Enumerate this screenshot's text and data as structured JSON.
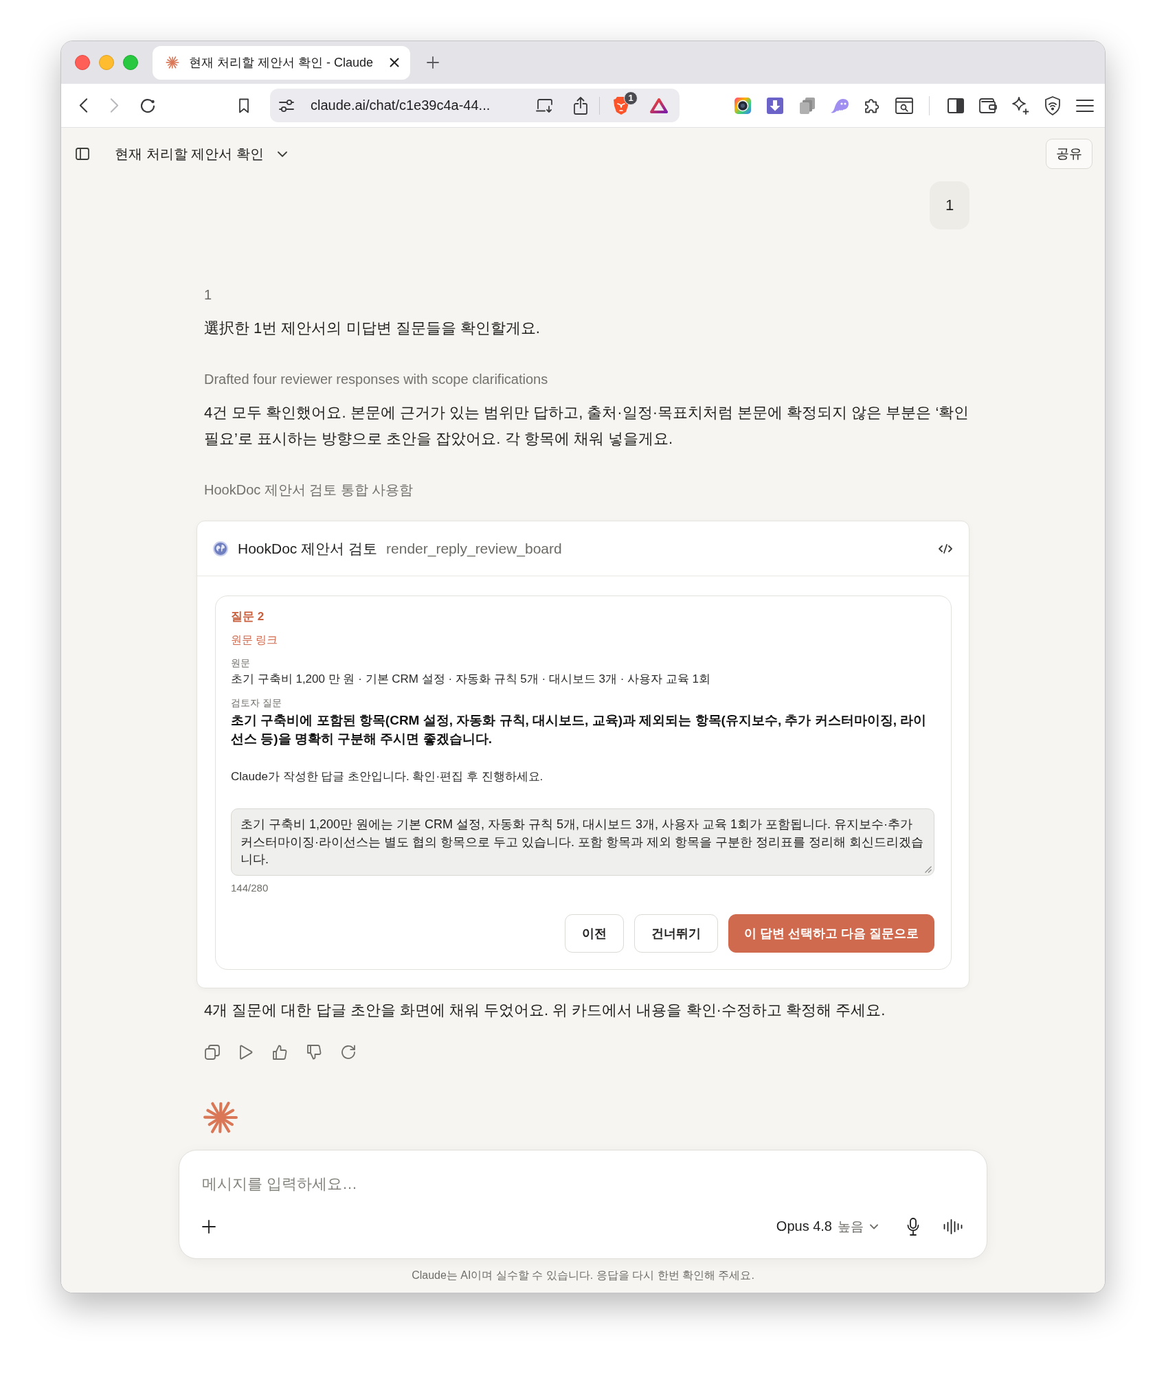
{
  "window": {
    "tabs": [
      {
        "title": "현재 처리할 제안서 확인 - Claude",
        "selected": true
      }
    ],
    "navigation": {
      "back_disabled": false,
      "forward_disabled": true
    },
    "address": "claude.ai/chat/c1e39c4a-44...",
    "shields_badge": "1"
  },
  "header": {
    "title": "현재 처리할 제안서 확인",
    "share": "공유"
  },
  "conversation": {
    "user_message": "1",
    "assistant_blocks": [
      {
        "kind": "label",
        "text": "1"
      },
      {
        "kind": "text",
        "text": "選択한 1번 제안서의 미답변 질문들을 확인할게요."
      },
      {
        "kind": "summary",
        "text": "Drafted four reviewer responses with scope clarifications"
      },
      {
        "kind": "text",
        "text": "4건 모두 확인했어요. 본문에 근거가 있는 범위만 답하고, 출처·일정·목표치처럼 본문에 확정되지 않은 부분은 ‘확인 필요’로 표시하는 방향으로 초안을 잡았어요. 각 항목에 채워 넣을게요."
      },
      {
        "kind": "summary",
        "text": "HookDoc 제안서 검토 통합 사용함"
      }
    ],
    "tool_card": {
      "app": "HookDoc 제안서 검토",
      "tool": "render_reply_review_board",
      "question": {
        "heading": "질문 2",
        "source_link": "원문 링크",
        "fields": [
          {
            "label": "원문",
            "value": "초기 구축비 1,200 만 원 · 기본 CRM 설정 · 자동화 규칙 5개 · 대시보드 3개 · 사용자 교육 1회",
            "kind": "plain"
          },
          {
            "label": "검토자 질문",
            "value": "초기 구축비에 포함된 항목(CRM 설정, 자동화 규칙, 대시보드, 교육)과 제외되는 항목(유지보수, 추가 커스터마이징, 라이선스 등)을 명확히 구분해 주시면 좋겠습니다.",
            "kind": "emphasis"
          }
        ],
        "draft_note": "Claude가 작성한 답글 초안입니다. 확인·편집 후 진행하세요.",
        "draft_reply": "초기 구축비 1,200만 원에는 기본 CRM 설정, 자동화 규칙 5개, 대시보드 3개, 사용자 교육 1회가 포함됩니다. 유지보수·추가 커스터마이징·라이선스는 별도 협의 항목으로 두고 있습니다. 포함 항목과 제외 항목을 구분한 정리표를 정리해 회신드리겠습니다.",
        "char_count": "144/280",
        "buttons": [
          {
            "label": "이전",
            "kind": "secondary"
          },
          {
            "label": "건너뛰기",
            "kind": "secondary"
          },
          {
            "label": "이 답변 선택하고 다음 질문으로",
            "kind": "primary"
          }
        ]
      }
    },
    "closing_text": "4개 질문에 대한 답글 초안을 화면에 채워 두었어요. 위 카드에서 내용을 확인·수정하고 확정해 주세요."
  },
  "composer": {
    "placeholder": "메시지를 입력하세요…",
    "model": "Opus 4.8",
    "effort": "높음"
  },
  "disclaimer": "Claude는 AI이며 실수할 수 있습니다. 응답을 다시 한번 확인해 주세요."
}
